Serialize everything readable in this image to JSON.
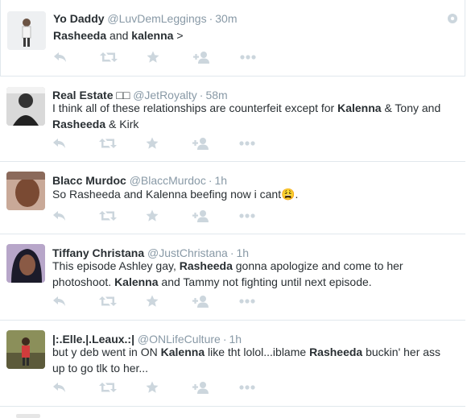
{
  "tweets": [
    {
      "name": "Yo Daddy",
      "handle": "@LuvDemLeggings",
      "time": "30m",
      "segments": [
        {
          "t": "Rasheeda",
          "b": true
        },
        {
          "t": " and ",
          "b": false
        },
        {
          "t": "kalenna",
          "b": true
        },
        {
          "t": " >",
          "b": false
        }
      ]
    },
    {
      "name": "Real Estate □□",
      "handle": "@JetRoyalty",
      "time": "58m",
      "segments": [
        {
          "t": "I think all of these relationships are counterfeit except for ",
          "b": false
        },
        {
          "t": "Kalenna",
          "b": true
        },
        {
          "t": " & Tony and ",
          "b": false
        },
        {
          "t": "Rasheeda",
          "b": true
        },
        {
          "t": " & Kirk",
          "b": false
        }
      ]
    },
    {
      "name": "Blacc Murdoc",
      "handle": "@BlaccMurdoc",
      "time": "1h",
      "segments": [
        {
          "t": "So Rasheeda and Kalenna beefing now i cant",
          "b": false
        },
        {
          "t": "😩",
          "b": false,
          "emoji": true
        },
        {
          "t": ".",
          "b": false
        }
      ]
    },
    {
      "name": "Tiffany Christana",
      "handle": "@JustChristana",
      "time": "1h",
      "segments": [
        {
          "t": "This episode Ashley gay, ",
          "b": false
        },
        {
          "t": "Rasheeda",
          "b": true
        },
        {
          "t": " gonna apologize and come to her photoshoot. ",
          "b": false
        },
        {
          "t": "Kalenna",
          "b": true
        },
        {
          "t": " and Tammy not fighting until next episode.",
          "b": false
        }
      ]
    },
    {
      "name": "|:.Elle.|.Leaux.:|",
      "handle": "@ONLifeCulture",
      "time": "1h",
      "segments": [
        {
          "t": "but y deb went in ON ",
          "b": false
        },
        {
          "t": "Kalenna",
          "b": true
        },
        {
          "t": " like tht lolol...iblame ",
          "b": false
        },
        {
          "t": "Rasheeda",
          "b": true
        },
        {
          "t": " buckin' her ass up to go tlk to her...",
          "b": false
        }
      ]
    }
  ],
  "separator": "·",
  "icons": [
    "reply-icon",
    "retweet-icon",
    "favorite-icon",
    "follow-icon",
    "more-icon"
  ],
  "colors": {
    "action_icon": "#ccd6dd",
    "name": "#292f33",
    "meta": "#8899a6",
    "divider": "#e1e8ed"
  }
}
